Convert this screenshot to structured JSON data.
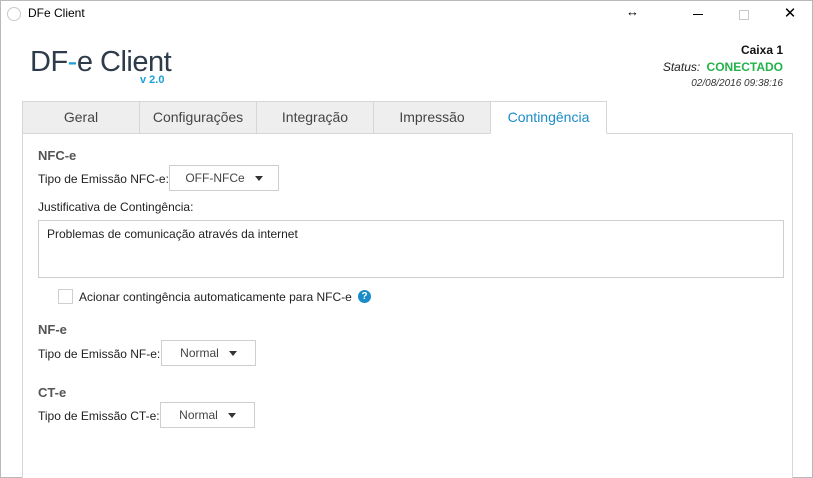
{
  "window": {
    "title": "DFe Client",
    "resize_icon": "↔",
    "close_glyph": "✕"
  },
  "header": {
    "logo_prefix": "DF",
    "logo_dash": "-",
    "logo_suffix": "e Client",
    "logo_version": "v 2.0",
    "caixa": "Caixa 1",
    "status_label": "Status:",
    "status_value": "CONECTADO",
    "datetime": "02/08/2016 09:38:16"
  },
  "tabs": [
    {
      "label": "Geral"
    },
    {
      "label": "Configurações"
    },
    {
      "label": "Integração"
    },
    {
      "label": "Impressão"
    },
    {
      "label": "Contingência"
    }
  ],
  "active_tab": "Contingência",
  "nfce": {
    "title": "NFC-e",
    "tipo_label": "Tipo de Emissão NFC-e:",
    "tipo_value": "OFF-NFCe",
    "justificativa_label": "Justificativa de Contingência:",
    "justificativa_value": "Problemas de comunicação através da internet",
    "auto_checkbox_label": "Acionar contingência automaticamente para NFC-e",
    "auto_checked": false,
    "help_glyph": "?"
  },
  "nfe": {
    "title": "NF-e",
    "tipo_label": "Tipo de Emissão NF-e:",
    "tipo_value": "Normal"
  },
  "cte": {
    "title": "CT-e",
    "tipo_label": "Tipo de Emissão CT-e:",
    "tipo_value": "Normal"
  },
  "colors": {
    "accent": "#1a8cc8",
    "status_connected": "#22b34a",
    "logo_dark": "#2e3b4a"
  }
}
